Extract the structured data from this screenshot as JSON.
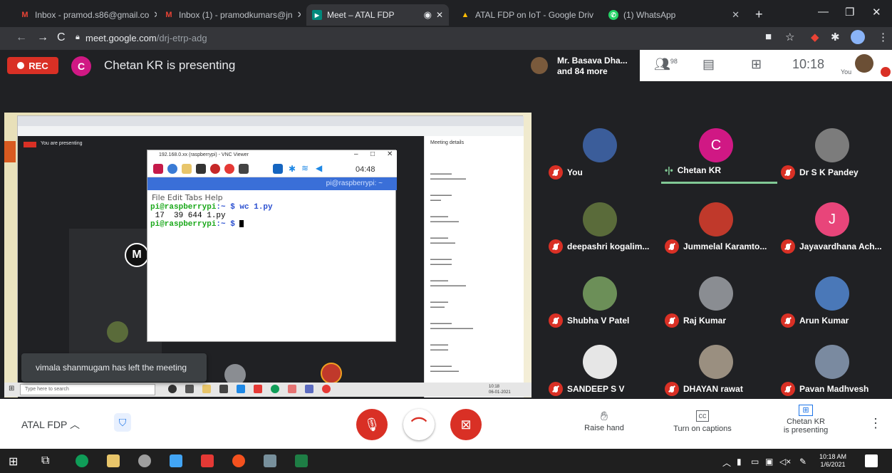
{
  "browser": {
    "tabs": [
      {
        "label": "Inbox - pramod.s86@gmail.co",
        "icon": "gmail-icon"
      },
      {
        "label": "Inbox (1) - pramodkumars@jn",
        "icon": "gmail-icon"
      },
      {
        "label": "Meet – ATAL FDP",
        "icon": "meet-icon"
      },
      {
        "label": "",
        "icon": "audio-icon"
      },
      {
        "label": "ATAL FDP on IoT - Google Driv",
        "icon": "drive-icon"
      },
      {
        "label": "(1) WhatsApp",
        "icon": "whatsapp-icon"
      }
    ],
    "url_domain": "meet.google.com",
    "url_path": "/drj-etrp-adg"
  },
  "meet": {
    "rec_label": "REC",
    "presenter_initial": "C",
    "presenting_title": "Chetan KR is presenting",
    "people_line1": "Mr. Basava Dha...",
    "people_line2": "and 84 more",
    "participant_count": "98",
    "time": "10:18",
    "you_label": "You",
    "toast": "vimala shanmugam has left the meeting",
    "meeting_name": "ATAL FDP",
    "controls": {
      "raise_hand": "Raise hand",
      "captions": "Turn on captions",
      "presenting_line1": "Chetan KR",
      "presenting_line2": "is presenting"
    }
  },
  "participants": [
    {
      "name": "You",
      "muted": true,
      "avatar_color": "#3b5d9a",
      "initial": ""
    },
    {
      "name": "Chetan KR",
      "muted": false,
      "avatar_color": "#d01884",
      "initial": "C"
    },
    {
      "name": "Dr S K Pandey",
      "muted": true,
      "avatar_color": "#7c7c7c",
      "initial": ""
    },
    {
      "name": "deepashri kogalim...",
      "muted": true,
      "avatar_color": "#5a6b3a",
      "initial": ""
    },
    {
      "name": "Jummelal Karamto...",
      "muted": true,
      "avatar_color": "#c0392b",
      "initial": ""
    },
    {
      "name": "Jayavardhana Ach...",
      "muted": true,
      "avatar_color": "#e8457a",
      "initial": "J"
    },
    {
      "name": "Shubha V Patel",
      "muted": true,
      "avatar_color": "#6c8f58",
      "initial": ""
    },
    {
      "name": "Raj Kumar",
      "muted": true,
      "avatar_color": "#8a8d92",
      "initial": ""
    },
    {
      "name": "Arun Kumar",
      "muted": true,
      "avatar_color": "#4a78b8",
      "initial": ""
    },
    {
      "name": "SANDEEP S V",
      "muted": true,
      "avatar_color": "#e6e6e6",
      "initial": ""
    },
    {
      "name": "DHAYAN rawat",
      "muted": true,
      "avatar_color": "#9a8f80",
      "initial": ""
    },
    {
      "name": "Pavan Madhvesh",
      "muted": true,
      "avatar_color": "#7a8aa0",
      "initial": ""
    }
  ],
  "shared_screen": {
    "vnc_title": "192.168.0.xx (raspberrypi) - VNC Viewer",
    "vnc_time": "04:48",
    "host": "pi@raspberrypi: ~",
    "menu": "File  Edit  Tabs  Help",
    "term_line1_prompt": "pi@raspberrypi",
    "term_line1_cmd": ":~ $ wc 1.py",
    "term_line2": " 17  39 644 1.py",
    "term_line3_prompt": "pi@raspberrypi",
    "term_line3_cmd": ":~ $ ",
    "you_are_presenting": "You are presenting",
    "meeting_details": "Meeting details",
    "search_placeholder": "Type here to search",
    "inner_time": "10:18",
    "inner_date": "06-01-2021"
  },
  "taskbar": {
    "time": "10:18 AM",
    "date": "1/6/2021"
  },
  "colors": {
    "accent_red": "#d93025",
    "meet_dark": "#202124",
    "active_speaker": "#81c995"
  }
}
